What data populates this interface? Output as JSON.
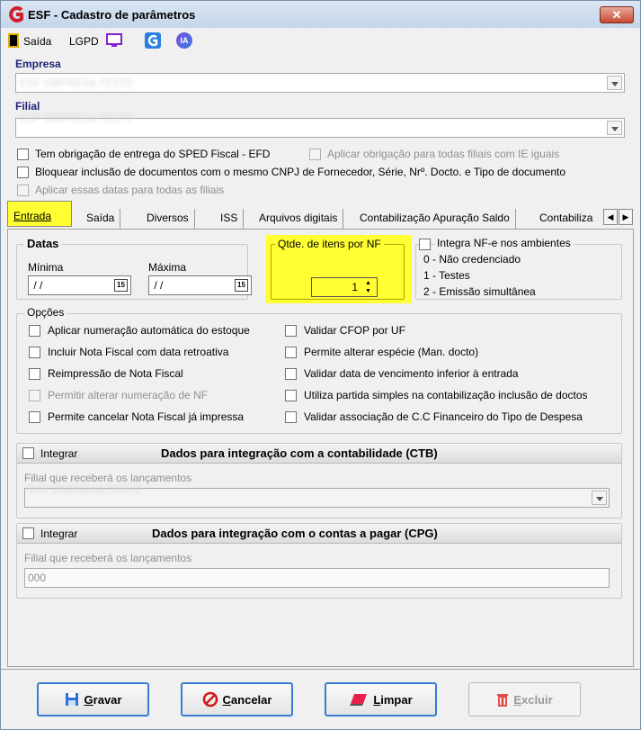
{
  "window": {
    "title": "ESF - Cadastro de parâmetros",
    "close_label": "✕"
  },
  "toolbar": {
    "exit_label": "Saída",
    "lgpd_label": "LGPD",
    "ia_label": "IA"
  },
  "empresa": {
    "label": "Empresa",
    "value": "ESF EMPRESA TESTE"
  },
  "filial": {
    "label": "Filial",
    "value": "ESF EMPRESA TESTE"
  },
  "checks": {
    "sped": "Tem obrigação de entrega do SPED Fiscal - EFD",
    "aplicar_ie": "Aplicar obrigação para todas filiais com IE iguais",
    "bloquear": "Bloquear inclusão de documentos com o mesmo CNPJ de Fornecedor, Série, Nrº. Docto. e Tipo de documento",
    "aplicar_datas": "Aplicar essas datas para todas as filiais"
  },
  "tabs": [
    "Entrada",
    "Saída",
    "Diversos",
    "ISS",
    "Arquivos digitais",
    "Contabilização Apuração Saldo",
    "Contabiliza"
  ],
  "datas": {
    "title": "Datas",
    "min_label": "Mínima",
    "max_label": "Máxima",
    "min_value": " / /",
    "max_value": " / /",
    "cal_icon": "15"
  },
  "qtde": {
    "label": "Qtde. de itens por NF",
    "value": "1"
  },
  "integra": {
    "label": "Integra NF-e nos ambientes",
    "opt0": "0 - Não credenciado",
    "opt1": "1 - Testes",
    "opt2": "2 - Emissão simultânea"
  },
  "opcoes": {
    "title": "Opções",
    "left": [
      "Aplicar numeração automática do estoque",
      "Incluir Nota Fiscal com data retroativa",
      "Reimpressão de Nota Fiscal",
      "Permitir alterar numeração de NF",
      "Permite cancelar Nota Fiscal já impressa"
    ],
    "right": [
      "Validar CFOP por UF",
      "Permite alterar espécie (Man. docto)",
      "Validar data de vencimento inferior à entrada",
      "Utiliza partida simples na contabilização inclusão de doctos",
      "Validar associação de C.C Financeiro do Tipo de Despesa"
    ]
  },
  "ctb": {
    "integrar": "Integrar",
    "title": "Dados para integração com a contabilidade (CTB)",
    "filial_label": "Filial que receberá os lançamentos",
    "filial_value": "ESF EMPRESA TESTE"
  },
  "cpg": {
    "integrar": "Integrar",
    "title": "Dados para integração com o contas a pagar (CPG)",
    "filial_label": "Filial que receberá os lançamentos",
    "filial_value": "000"
  },
  "buttons": {
    "gravar_u": "G",
    "gravar": "ravar",
    "cancelar_u": "C",
    "cancelar": "ancelar",
    "limpar_u": "L",
    "limpar": "impar",
    "excluir_u": "E",
    "excluir": "xcluir"
  }
}
